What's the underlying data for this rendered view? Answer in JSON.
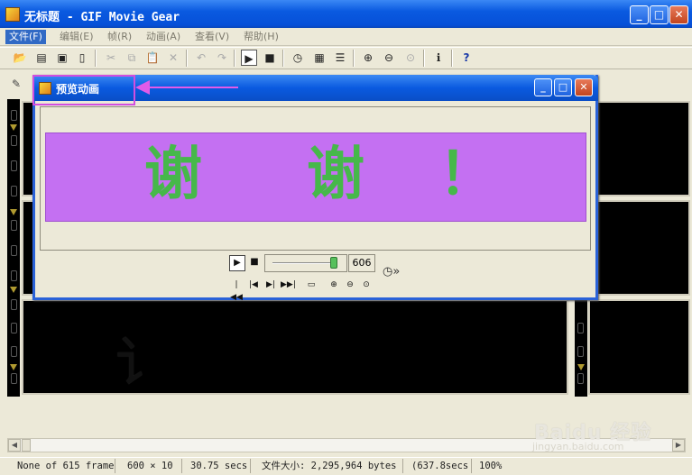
{
  "window": {
    "title": "无标题 - GIF Movie Gear"
  },
  "menubar": {
    "items": [
      "文件(F)",
      "编辑(E)",
      "帧(R)",
      "动画(A)",
      "查看(V)",
      "帮助(H)"
    ]
  },
  "preview": {
    "title": "预览动画",
    "banner_text": [
      "谢",
      "谢",
      "！"
    ],
    "banner_color": "#c470f2",
    "text_color": "#46b84a",
    "speed_value": "606",
    "slider_level": 0.95
  },
  "statusbar": {
    "selection": "None of 615 frames",
    "dimensions": "600 × 10",
    "duration": "30.75 secs",
    "filesize": "文件大小: 2,295,964 bytes",
    "extra": "(637.8secs",
    "zoom": "100%"
  },
  "watermark": {
    "main": "Baidu 经验",
    "sub": "jingyan.baidu.com"
  },
  "colors": {
    "titlebar": "#0a5ae0",
    "highlight": "#d24ee0",
    "arrow": "#e25be8"
  }
}
